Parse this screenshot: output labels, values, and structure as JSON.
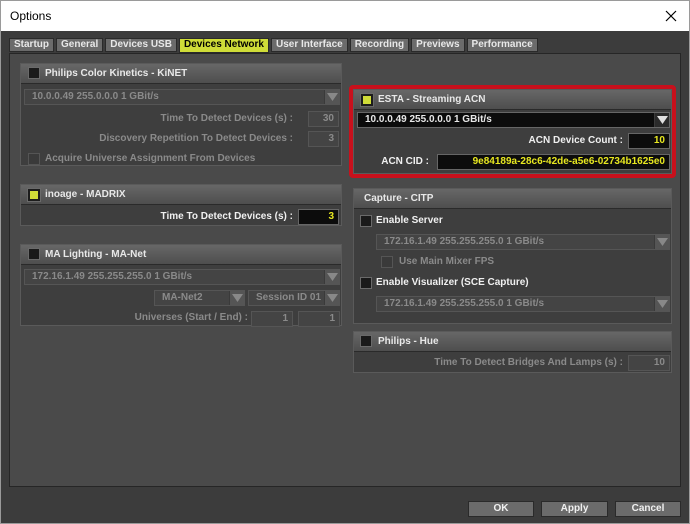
{
  "window": {
    "title": "Options"
  },
  "tabs": [
    "Startup",
    "General",
    "Devices USB",
    "Devices Network",
    "User Interface",
    "Recording",
    "Previews",
    "Performance"
  ],
  "active_tab": "Devices Network",
  "kinet": {
    "title": "Philips Color Kinetics - KiNET",
    "adapter": "10.0.0.49 255.0.0.0 1 GBit/s",
    "detect_label": "Time To Detect Devices (s) :",
    "detect_value": "30",
    "discovery_label": "Discovery Repetition To Detect Devices :",
    "discovery_value": "3",
    "assign_label": "Acquire Universe Assignment From Devices"
  },
  "inoage": {
    "title": "inoage - MADRIX",
    "detect_label": "Time To Detect Devices (s) :",
    "detect_value": "3"
  },
  "manet": {
    "title": "MA Lighting - MA-Net",
    "adapter": "172.16.1.49 255.255.255.0 1 GBit/s",
    "version": "MA-Net2",
    "session": "Session ID 01",
    "universes_label": "Universes (Start / End) :",
    "universe_start": "1",
    "universe_end": "1"
  },
  "acn": {
    "title": "ESTA - Streaming ACN",
    "adapter": "10.0.0.49 255.0.0.0 1 GBit/s",
    "count_label": "ACN Device Count :",
    "count_value": "10",
    "cid_label": "ACN CID :",
    "cid_value": "9e84189a-28c6-42de-a5e6-02734b1625e0"
  },
  "citp": {
    "title": "Capture - CITP",
    "server_label": "Enable Server",
    "server_adapter": "172.16.1.49 255.255.255.0 1 GBit/s",
    "mixer_label": "Use Main Mixer FPS",
    "visualizer_label": "Enable Visualizer (SCE Capture)",
    "visualizer_adapter": "172.16.1.49 255.255.255.0 1 GBit/s"
  },
  "hue": {
    "title": "Philips - Hue",
    "detect_label": "Time To Detect Bridges And Lamps (s) :",
    "detect_value": "10"
  },
  "footer": {
    "ok": "OK",
    "apply": "Apply",
    "cancel": "Cancel"
  },
  "colors": {
    "accent": "#cfdc38",
    "highlight": "#c8101c"
  },
  "icons": {
    "close": "close-icon",
    "dropdown": "chevron-down-icon"
  }
}
